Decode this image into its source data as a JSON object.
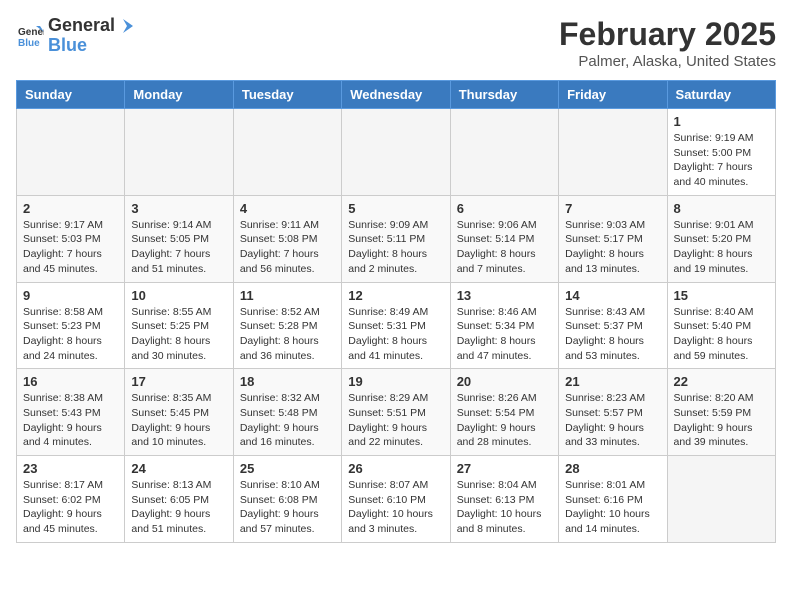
{
  "logo": {
    "general": "General",
    "blue": "Blue"
  },
  "header": {
    "month": "February 2025",
    "location": "Palmer, Alaska, United States"
  },
  "weekdays": [
    "Sunday",
    "Monday",
    "Tuesday",
    "Wednesday",
    "Thursday",
    "Friday",
    "Saturday"
  ],
  "weeks": [
    [
      {
        "day": "",
        "info": ""
      },
      {
        "day": "",
        "info": ""
      },
      {
        "day": "",
        "info": ""
      },
      {
        "day": "",
        "info": ""
      },
      {
        "day": "",
        "info": ""
      },
      {
        "day": "",
        "info": ""
      },
      {
        "day": "1",
        "info": "Sunrise: 9:19 AM\nSunset: 5:00 PM\nDaylight: 7 hours and 40 minutes."
      }
    ],
    [
      {
        "day": "2",
        "info": "Sunrise: 9:17 AM\nSunset: 5:03 PM\nDaylight: 7 hours and 45 minutes."
      },
      {
        "day": "3",
        "info": "Sunrise: 9:14 AM\nSunset: 5:05 PM\nDaylight: 7 hours and 51 minutes."
      },
      {
        "day": "4",
        "info": "Sunrise: 9:11 AM\nSunset: 5:08 PM\nDaylight: 7 hours and 56 minutes."
      },
      {
        "day": "5",
        "info": "Sunrise: 9:09 AM\nSunset: 5:11 PM\nDaylight: 8 hours and 2 minutes."
      },
      {
        "day": "6",
        "info": "Sunrise: 9:06 AM\nSunset: 5:14 PM\nDaylight: 8 hours and 7 minutes."
      },
      {
        "day": "7",
        "info": "Sunrise: 9:03 AM\nSunset: 5:17 PM\nDaylight: 8 hours and 13 minutes."
      },
      {
        "day": "8",
        "info": "Sunrise: 9:01 AM\nSunset: 5:20 PM\nDaylight: 8 hours and 19 minutes."
      }
    ],
    [
      {
        "day": "9",
        "info": "Sunrise: 8:58 AM\nSunset: 5:23 PM\nDaylight: 8 hours and 24 minutes."
      },
      {
        "day": "10",
        "info": "Sunrise: 8:55 AM\nSunset: 5:25 PM\nDaylight: 8 hours and 30 minutes."
      },
      {
        "day": "11",
        "info": "Sunrise: 8:52 AM\nSunset: 5:28 PM\nDaylight: 8 hours and 36 minutes."
      },
      {
        "day": "12",
        "info": "Sunrise: 8:49 AM\nSunset: 5:31 PM\nDaylight: 8 hours and 41 minutes."
      },
      {
        "day": "13",
        "info": "Sunrise: 8:46 AM\nSunset: 5:34 PM\nDaylight: 8 hours and 47 minutes."
      },
      {
        "day": "14",
        "info": "Sunrise: 8:43 AM\nSunset: 5:37 PM\nDaylight: 8 hours and 53 minutes."
      },
      {
        "day": "15",
        "info": "Sunrise: 8:40 AM\nSunset: 5:40 PM\nDaylight: 8 hours and 59 minutes."
      }
    ],
    [
      {
        "day": "16",
        "info": "Sunrise: 8:38 AM\nSunset: 5:43 PM\nDaylight: 9 hours and 4 minutes."
      },
      {
        "day": "17",
        "info": "Sunrise: 8:35 AM\nSunset: 5:45 PM\nDaylight: 9 hours and 10 minutes."
      },
      {
        "day": "18",
        "info": "Sunrise: 8:32 AM\nSunset: 5:48 PM\nDaylight: 9 hours and 16 minutes."
      },
      {
        "day": "19",
        "info": "Sunrise: 8:29 AM\nSunset: 5:51 PM\nDaylight: 9 hours and 22 minutes."
      },
      {
        "day": "20",
        "info": "Sunrise: 8:26 AM\nSunset: 5:54 PM\nDaylight: 9 hours and 28 minutes."
      },
      {
        "day": "21",
        "info": "Sunrise: 8:23 AM\nSunset: 5:57 PM\nDaylight: 9 hours and 33 minutes."
      },
      {
        "day": "22",
        "info": "Sunrise: 8:20 AM\nSunset: 5:59 PM\nDaylight: 9 hours and 39 minutes."
      }
    ],
    [
      {
        "day": "23",
        "info": "Sunrise: 8:17 AM\nSunset: 6:02 PM\nDaylight: 9 hours and 45 minutes."
      },
      {
        "day": "24",
        "info": "Sunrise: 8:13 AM\nSunset: 6:05 PM\nDaylight: 9 hours and 51 minutes."
      },
      {
        "day": "25",
        "info": "Sunrise: 8:10 AM\nSunset: 6:08 PM\nDaylight: 9 hours and 57 minutes."
      },
      {
        "day": "26",
        "info": "Sunrise: 8:07 AM\nSunset: 6:10 PM\nDaylight: 10 hours and 3 minutes."
      },
      {
        "day": "27",
        "info": "Sunrise: 8:04 AM\nSunset: 6:13 PM\nDaylight: 10 hours and 8 minutes."
      },
      {
        "day": "28",
        "info": "Sunrise: 8:01 AM\nSunset: 6:16 PM\nDaylight: 10 hours and 14 minutes."
      },
      {
        "day": "",
        "info": ""
      }
    ]
  ]
}
